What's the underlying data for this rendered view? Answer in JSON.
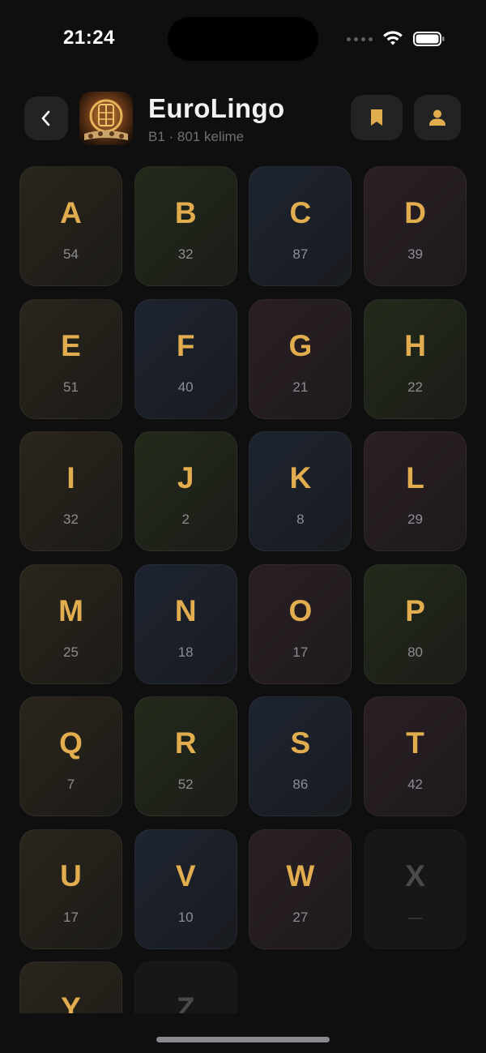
{
  "status_bar": {
    "time": "21:24"
  },
  "header": {
    "title": "EuroLingo",
    "subtitle": "B1 · 801 kelime",
    "back_icon": "chevron-left-icon",
    "bookmark_icon": "bookmark-icon",
    "profile_icon": "person-icon"
  },
  "colors": {
    "accent": "#e1ad4e",
    "background": "#0f0f10",
    "button_bg": "#232325",
    "muted_text": "#8d8d92",
    "disabled": "#4a4a4d"
  },
  "letters": [
    {
      "letter": "A",
      "count": "54",
      "tint": 0
    },
    {
      "letter": "B",
      "count": "32",
      "tint": 1
    },
    {
      "letter": "C",
      "count": "87",
      "tint": 2
    },
    {
      "letter": "D",
      "count": "39",
      "tint": 3
    },
    {
      "letter": "E",
      "count": "51",
      "tint": 0
    },
    {
      "letter": "F",
      "count": "40",
      "tint": 2
    },
    {
      "letter": "G",
      "count": "21",
      "tint": 3
    },
    {
      "letter": "H",
      "count": "22",
      "tint": 1
    },
    {
      "letter": "I",
      "count": "32",
      "tint": 0
    },
    {
      "letter": "J",
      "count": "2",
      "tint": 1
    },
    {
      "letter": "K",
      "count": "8",
      "tint": 2
    },
    {
      "letter": "L",
      "count": "29",
      "tint": 3
    },
    {
      "letter": "M",
      "count": "25",
      "tint": 0
    },
    {
      "letter": "N",
      "count": "18",
      "tint": 2
    },
    {
      "letter": "O",
      "count": "17",
      "tint": 3
    },
    {
      "letter": "P",
      "count": "80",
      "tint": 1
    },
    {
      "letter": "Q",
      "count": "7",
      "tint": 0
    },
    {
      "letter": "R",
      "count": "52",
      "tint": 1
    },
    {
      "letter": "S",
      "count": "86",
      "tint": 2
    },
    {
      "letter": "T",
      "count": "42",
      "tint": 3
    },
    {
      "letter": "U",
      "count": "17",
      "tint": 0
    },
    {
      "letter": "V",
      "count": "10",
      "tint": 2
    },
    {
      "letter": "W",
      "count": "27",
      "tint": 3
    },
    {
      "letter": "X",
      "count": "—",
      "tint": -1
    },
    {
      "letter": "Y",
      "count": "",
      "tint": 0
    },
    {
      "letter": "Z",
      "count": "",
      "tint": -1
    }
  ]
}
